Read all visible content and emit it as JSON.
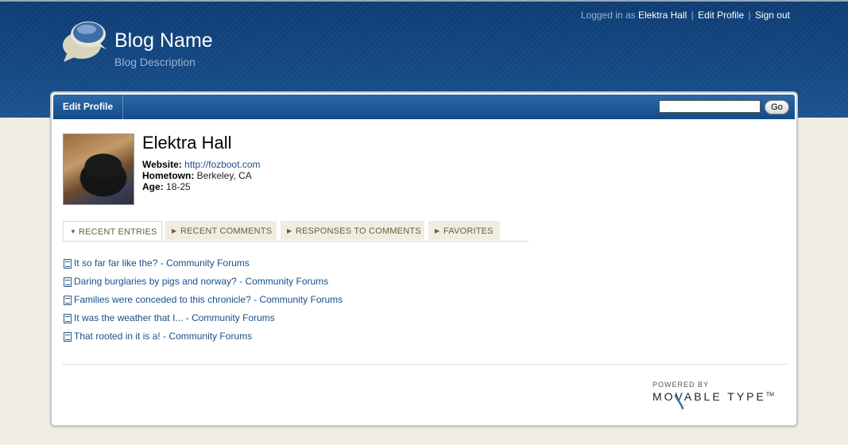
{
  "header": {
    "blog_name": "Blog Name",
    "blog_description": "Blog Description",
    "logged_in_prefix": "Logged in as",
    "user_name": "Elektra Hall",
    "edit_profile_link": "Edit Profile",
    "sign_out_link": "Sign out"
  },
  "navbar": {
    "tab_label": "Edit Profile",
    "search_value": "",
    "go_label": "Go"
  },
  "profile": {
    "name": "Elektra Hall",
    "website_label": "Website:",
    "website_value": "http://fozboot.com",
    "hometown_label": "Hometown:",
    "hometown_value": "Berkeley, CA",
    "age_label": "Age:",
    "age_value": "18-25"
  },
  "tabs": [
    {
      "label": "RECENT ENTRIES",
      "active": true
    },
    {
      "label": "RECENT COMMENTS",
      "active": false
    },
    {
      "label": "RESPONSES TO COMMENTS",
      "active": false
    },
    {
      "label": "FAVORITES",
      "active": false
    }
  ],
  "entries": [
    {
      "title": "It so far far like the?",
      "source": "Community Forums"
    },
    {
      "title": "Daring burglaries by pigs and norway?",
      "source": "Community Forums"
    },
    {
      "title": "Families were conceded to this chronicle?",
      "source": "Community Forums"
    },
    {
      "title": "It was the weather that I...",
      "source": "Community Forums"
    },
    {
      "title": "That rooted in it is a!",
      "source": "Community Forums"
    }
  ],
  "footer": {
    "powered_by": "POWERED BY",
    "brand": "MOVABLE TYPE",
    "trademark": "TM"
  },
  "colors": {
    "banner": "#154a86",
    "link": "#1a4f8a",
    "page_background": "#f0ede4"
  },
  "icons": [
    "speech-bubble-logo",
    "doc-icon",
    "tab-arrow-icon"
  ]
}
